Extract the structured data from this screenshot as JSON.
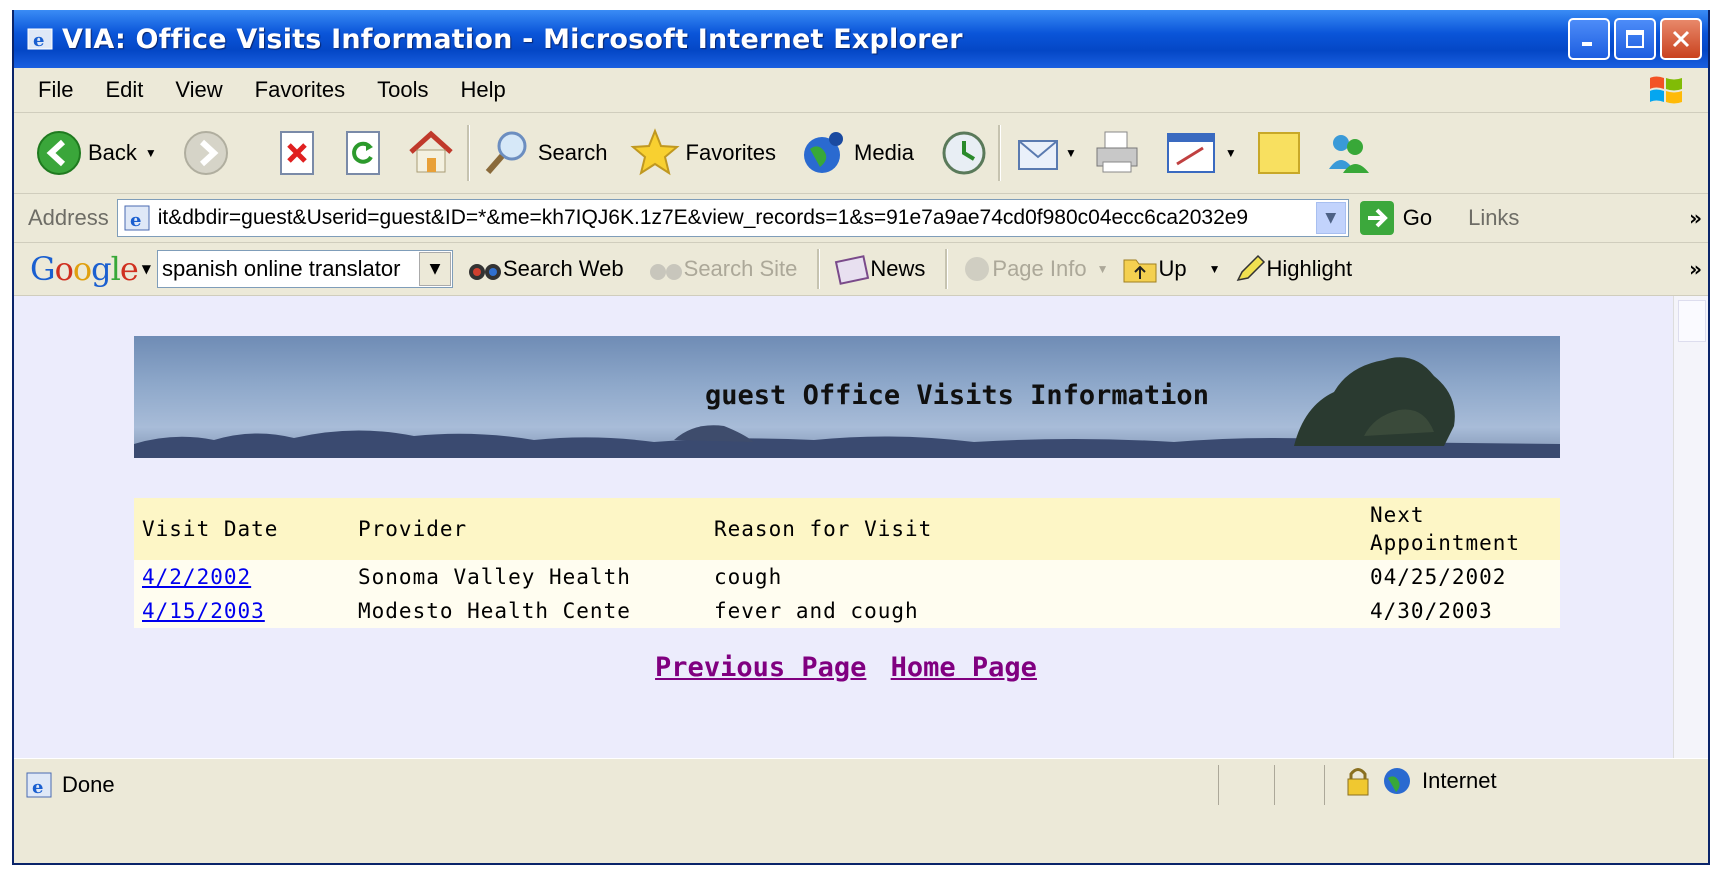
{
  "window": {
    "title": "VIA: Office Visits Information - Microsoft Internet Explorer"
  },
  "menu": [
    "File",
    "Edit",
    "View",
    "Favorites",
    "Tools",
    "Help"
  ],
  "toolbar": {
    "back_label": "Back",
    "search_label": "Search",
    "favorites_label": "Favorites",
    "media_label": "Media"
  },
  "address": {
    "label": "Address",
    "url": "it&dbdir=guest&Userid=guest&ID=*&me=kh7IQJ6K.1z7E&view_records=1&s=91e7a9ae74cd0f980c04ecc6ca2032e9",
    "go_label": "Go",
    "links_label": "Links"
  },
  "google_bar": {
    "logo": "Google",
    "search_value": "spanish online translator",
    "search_web": "Search Web",
    "search_site": "Search Site",
    "news": "News",
    "page_info": "Page Info",
    "up": "Up",
    "highlight": "Highlight"
  },
  "page": {
    "banner_title": "guest Office Visits Information",
    "columns": [
      "Visit Date",
      "Provider",
      "Reason for Visit",
      "Next Appointment"
    ],
    "rows": [
      {
        "date": "4/2/2002",
        "provider": "Sonoma Valley Health",
        "reason": "cough",
        "next": "04/25/2002"
      },
      {
        "date": "4/15/2003",
        "provider": "Modesto Health Cente",
        "reason": "fever and cough",
        "next": "4/30/2003"
      }
    ],
    "prev_link": "Previous Page",
    "home_link": "Home Page"
  },
  "status": {
    "text": "Done",
    "zone": "Internet"
  },
  "colors": {
    "title_bar": "#0a55d9",
    "content_bg": "#ececfc",
    "header_row": "#fdf6c6",
    "visited_link": "#800080",
    "link": "#0000ee"
  }
}
